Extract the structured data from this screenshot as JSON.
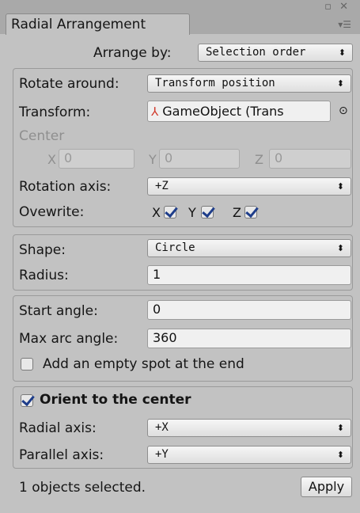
{
  "window": {
    "tab_title": "Radial Arrangement",
    "controls": "▫ ✕",
    "tab_menu": "▾☰"
  },
  "arrange": {
    "label": "Arrange by:",
    "value": "Selection order"
  },
  "rotate_around": {
    "label": "Rotate around:",
    "value": "Transform position"
  },
  "transform": {
    "label": "Transform:",
    "value": "GameObject (Trans",
    "target_icon": "⊙"
  },
  "center": {
    "label": "Center",
    "x_label": "X",
    "x_value": "0",
    "y_label": "Y",
    "y_value": "0",
    "z_label": "Z",
    "z_value": "0"
  },
  "rotation_axis": {
    "label": "Rotation axis:",
    "value": "+Z"
  },
  "overwrite": {
    "label": "Ovewrite:",
    "x": "X",
    "y": "Y",
    "z": "Z",
    "x_checked": true,
    "y_checked": true,
    "z_checked": true
  },
  "shape": {
    "label": "Shape:",
    "value": "Circle"
  },
  "radius": {
    "label": "Radius:",
    "value": "1"
  },
  "start_angle": {
    "label": "Start angle:",
    "value": "0"
  },
  "max_arc_angle": {
    "label": "Max arc angle:",
    "value": "360"
  },
  "empty_spot": {
    "label": "Add an empty spot at the end",
    "checked": false
  },
  "orient": {
    "label": "Orient to the center",
    "checked": true
  },
  "radial_axis": {
    "label": "Radial axis:",
    "value": "+X"
  },
  "parallel_axis": {
    "label": "Parallel axis:",
    "value": "+Y"
  },
  "footer": {
    "status": "1 objects selected.",
    "apply_label": "Apply"
  },
  "icons": {
    "dropdown_arrow": "⬍"
  }
}
